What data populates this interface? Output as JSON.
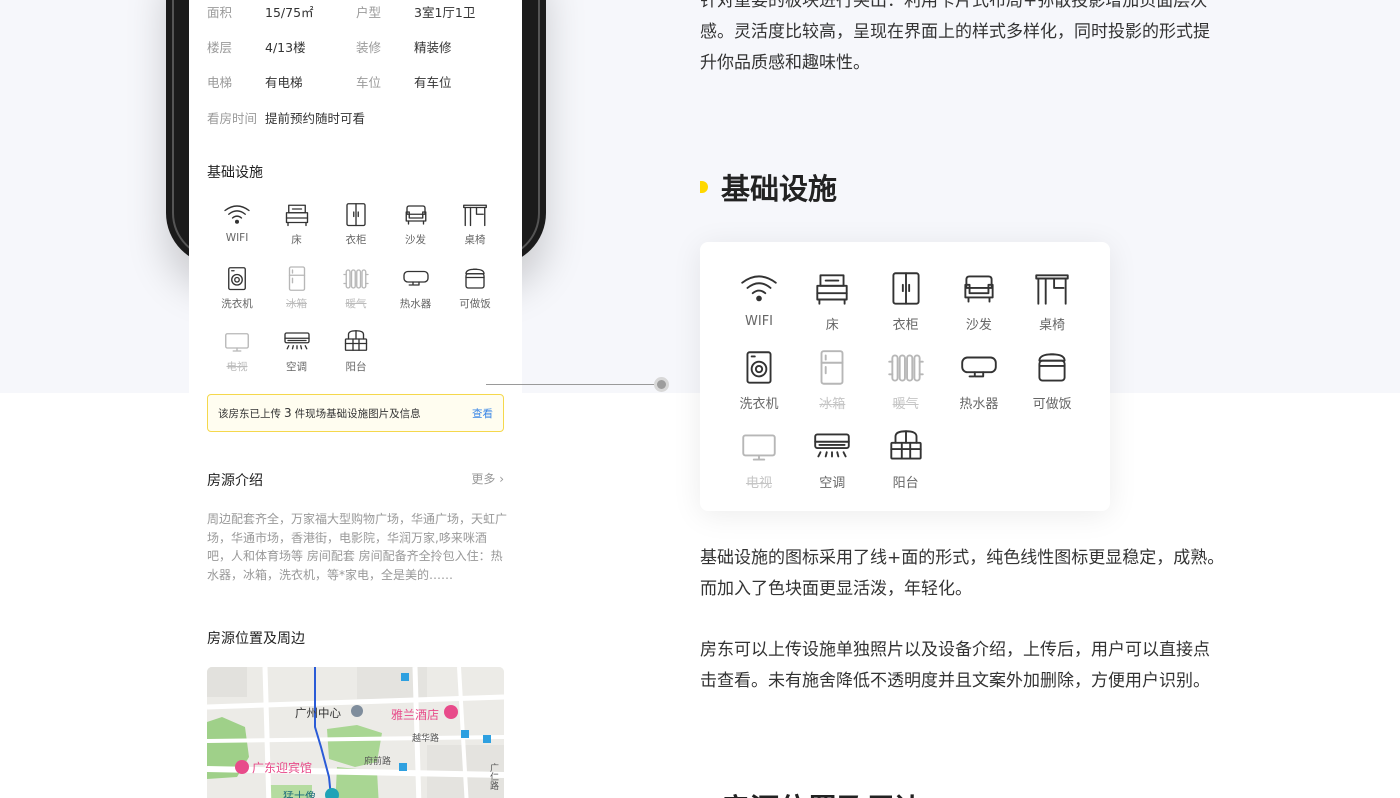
{
  "colors": {
    "accent": "#ffd800",
    "link": "#3a86e6",
    "notice_border": "#f5d84c",
    "pink_poi": "#e84b8a"
  },
  "phone": {
    "info_rows": [
      {
        "label1": "面积",
        "value1": "15/75㎡",
        "label2": "户型",
        "value2": "3室1厅1卫"
      },
      {
        "label1": "楼层",
        "value1": "4/13楼",
        "label2": "装修",
        "value2": "精装修"
      },
      {
        "label1": "电梯",
        "value1": "有电梯",
        "label2": "车位",
        "value2": "有车位"
      }
    ],
    "viewing_label": "看房时间",
    "viewing_value": "提前预约随时可看",
    "facilities_title": "基础设施",
    "facilities": [
      {
        "label": "WIFI",
        "icon": "wifi-icon",
        "dim": false
      },
      {
        "label": "床",
        "icon": "bed-icon",
        "dim": false
      },
      {
        "label": "衣柜",
        "icon": "wardrobe-icon",
        "dim": false
      },
      {
        "label": "沙发",
        "icon": "sofa-icon",
        "dim": false
      },
      {
        "label": "桌椅",
        "icon": "desk-chair-icon",
        "dim": false
      },
      {
        "label": "洗衣机",
        "icon": "washing-machine-icon",
        "dim": false
      },
      {
        "label": "冰箱",
        "icon": "fridge-icon",
        "dim": true
      },
      {
        "label": "暖气",
        "icon": "heater-icon",
        "dim": true
      },
      {
        "label": "热水器",
        "icon": "water-heater-icon",
        "dim": false
      },
      {
        "label": "可做饭",
        "icon": "rice-cooker-icon",
        "dim": false
      },
      {
        "label": "电视",
        "icon": "tv-icon",
        "dim": true
      },
      {
        "label": "空调",
        "icon": "air-conditioner-icon",
        "dim": false
      },
      {
        "label": "阳台",
        "icon": "balcony-icon",
        "dim": false
      }
    ],
    "notice_prefix": "该房东已上传",
    "notice_count": "3",
    "notice_suffix": "件现场基础设施图片及信息",
    "notice_link": "查看",
    "intro_title": "房源介绍",
    "intro_more": "更多",
    "intro_text": "周边配套齐全，万家福大型购物广场，华通广场，天虹广场，华通市场，香港街，电影院，华润万家,哆来咪酒吧，人和体育场等 房间配套 房间配备齐全拎包入住：热水器，冰箱，洗衣机，等*家电，全是美的……",
    "location_title": "房源位置及周边",
    "map": {
      "poi_center": "广州中心",
      "poi_hotel1": "雅兰酒店",
      "poi_hotel2": "广东迎宾馆",
      "road1": "越华路",
      "road2": "府前路",
      "road3": "广仁路",
      "poi_statue": "猛士像"
    }
  },
  "right": {
    "top_para_line1": "针对重要的板块进行突出：利用卡片式布局+弥散投影增加页面层次",
    "top_para_line2": "感。灵活度比较高，呈现在界面上的样式多样化，同时投影的形式提",
    "top_para_line3": "升你品质感和趣味性。",
    "heading": "基础设施",
    "desc1_line1": "基础设施的图标采用了线+面的形式，纯色线性图标更显稳定，成熟。",
    "desc1_line2": "而加入了色块面更显活泼，年轻化。",
    "desc2_line1": "房东可以上传设施单独照片以及设备介绍，上传后，用户可以直接点",
    "desc2_line2": "击查看。未有施舍降低不透明度并且文案外加删除，方便用户识别。",
    "next_heading": "房源位置及周边"
  }
}
